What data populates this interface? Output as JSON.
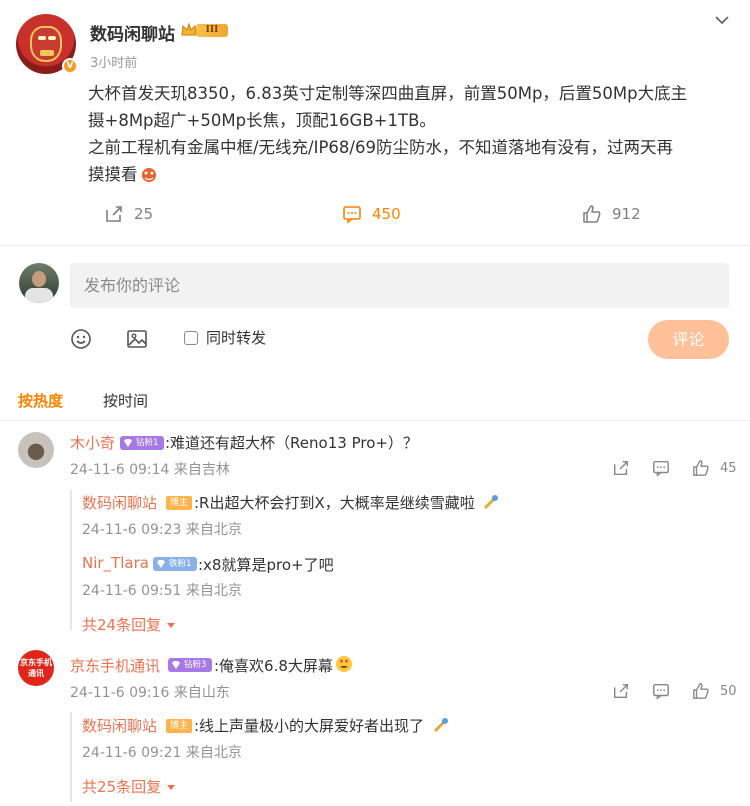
{
  "post": {
    "author": "数码闲聊站",
    "level_badge": "III",
    "time": "3小时前",
    "content_line1": "大杯首发天玑8350，6.83英寸定制等深四曲直屏，前置50Mp，后置50Mp大底主",
    "content_line2": "摄+8Mp超广+50Mp长焦，顶配16GB+1TB。",
    "content_line3": "之前工程机有金属中框/无线充/IP68/69防尘防水，不知道落地有没有，过两天再",
    "content_line4": "摸摸看",
    "reposts": "25",
    "comments": "450",
    "likes": "912"
  },
  "composer": {
    "placeholder": "发布你的评论",
    "repost_label": "同时转发",
    "submit_label": "评论"
  },
  "sort": {
    "hot": "按热度",
    "time": "按时间"
  },
  "comments": [
    {
      "name": "木小奇",
      "fan_badge": "钻粉1",
      "text": ":难道还有超大杯（Reno13 Pro+）？",
      "meta": "24-11-6 09:14 来自吉林",
      "likes": "45",
      "replies": [
        {
          "name": "数码闲聊站",
          "tag": "博主",
          "text": ":R出超大杯会打到X，大概率是继续雪藏啦",
          "meta": "24-11-6 09:23 来自北京"
        },
        {
          "name": "Nir_Tlara",
          "tag": "铁粉1",
          "text": ":x8就算是pro+了吧",
          "meta": "24-11-6 09:51 来自北京"
        }
      ],
      "more": "共24条回复"
    },
    {
      "name": "京东手机通讯",
      "avatar_text": "京东手机通讯",
      "fan_badge": "钻粉3",
      "text": ":俺喜欢6.8大屏幕",
      "meta": "24-11-6 09:16 来自山东",
      "likes": "50",
      "replies": [
        {
          "name": "数码闲聊站",
          "tag": "博主",
          "text": ":线上声量极小的大屏爱好者出现了",
          "meta": "24-11-6 09:21 来自北京"
        }
      ],
      "more": "共25条回复"
    }
  ],
  "colors": {
    "accent": "#ff8200",
    "name": "#eb7350",
    "submit_disabled": "#ffc09a"
  },
  "icons": [
    "chevron-down-icon",
    "repost-icon",
    "comment-icon",
    "like-icon",
    "emoji-icon",
    "image-icon",
    "pointer-emoji-icon",
    "heart-eyes-emoji-icon",
    "crab-emoji-icon"
  ]
}
